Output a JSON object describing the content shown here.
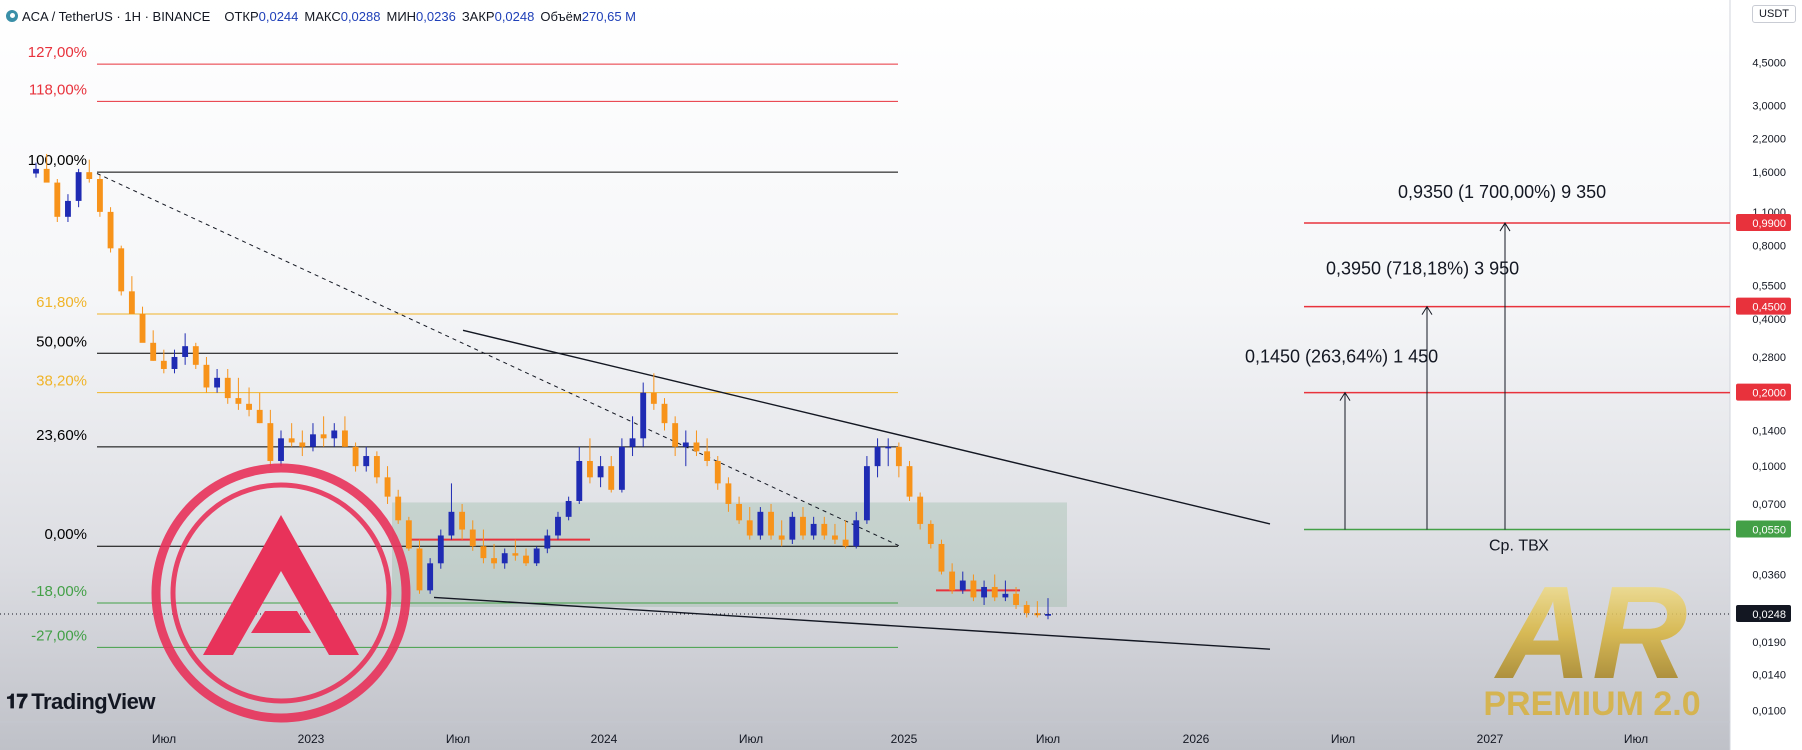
{
  "header": {
    "symbol": "ACA / TetherUS · 1H · BINANCE",
    "open_label": "ОТКР",
    "open_value": "0,0244",
    "high_label": "МАКС",
    "high_value": "0,0288",
    "low_label": "МИН",
    "low_value": "0,0236",
    "close_label": "ЗАКР",
    "close_value": "0,0248",
    "volume_label": "Объём",
    "volume_value": "270,65 M"
  },
  "currency": "USDT",
  "tradingview_label": "TradingView",
  "colors": {
    "up": "#1f2bb3",
    "down": "#f7931a",
    "red": "#e8323c",
    "green": "#43a047",
    "fib_gold": "#f0b429"
  },
  "chart_data": {
    "type": "candlestick",
    "y_scale": "log",
    "ylim": [
      0.0093,
      6.0
    ],
    "x_axis_labels": [
      "Июл",
      "2023",
      "Июл",
      "2024",
      "Июл",
      "2025",
      "Июл",
      "2026",
      "Июл",
      "2027",
      "Июл"
    ],
    "y_axis_labels": [
      "4,5000",
      "3,0000",
      "2,2000",
      "1,6000",
      "1,1000",
      "0,8000",
      "0,5500",
      "0,4000",
      "0,2800",
      "0,1400",
      "0,1000",
      "0,0700",
      "0,0360",
      "0,0190",
      "0,0140",
      "0,0100"
    ],
    "last_price": {
      "value": 0.0248,
      "label": "0,0248"
    },
    "price_tags": [
      {
        "value": 0.99,
        "label": "0,9900",
        "color": "#e8323c"
      },
      {
        "value": 0.45,
        "label": "0,4500",
        "color": "#e8323c"
      },
      {
        "value": 0.2,
        "label": "0,2000",
        "color": "#e8323c"
      },
      {
        "value": 0.055,
        "label": "0,0550",
        "color": "#43a047"
      }
    ],
    "fib_levels": [
      {
        "label": "127,00%",
        "value": 4.43,
        "color": "#e8323c"
      },
      {
        "label": "118,00%",
        "value": 3.12,
        "color": "#e8323c"
      },
      {
        "label": "100,00%",
        "value": 1.6,
        "color": "#000000"
      },
      {
        "label": "61,80%",
        "value": 0.42,
        "color": "#f0b429"
      },
      {
        "label": "50,00%",
        "value": 0.29,
        "color": "#000000"
      },
      {
        "label": "38,20%",
        "value": 0.2,
        "color": "#f0b429"
      },
      {
        "label": "23,60%",
        "value": 0.12,
        "color": "#000000"
      },
      {
        "label": "0,00%",
        "value": 0.047,
        "color": "#000000"
      },
      {
        "label": "-18,00%",
        "value": 0.0275,
        "color": "#43a047"
      },
      {
        "label": "-27,00%",
        "value": 0.0181,
        "color": "#43a047"
      }
    ],
    "targets": [
      {
        "label": "0,1450 (263,64%) 1 450",
        "from": 0.055,
        "to": 0.2
      },
      {
        "label": "0,3950 (718,18%) 3 950",
        "from": 0.055,
        "to": 0.45
      },
      {
        "label": "0,9350 (1 700,00%) 9 350",
        "from": 0.055,
        "to": 0.99
      }
    ],
    "entry_label": "Ср. ТВХ",
    "series": [
      {
        "values": [
          [
            1.58,
            1.75,
            1.52,
            1.65
          ],
          [
            1.65,
            1.9,
            1.55,
            1.45
          ],
          [
            1.45,
            1.5,
            1.0,
            1.05
          ],
          [
            1.05,
            1.3,
            1.0,
            1.22
          ],
          [
            1.22,
            1.65,
            1.15,
            1.6
          ],
          [
            1.6,
            1.8,
            1.45,
            1.5
          ],
          [
            1.5,
            1.55,
            1.05,
            1.1
          ],
          [
            1.1,
            1.15,
            0.75,
            0.78
          ],
          [
            0.78,
            0.8,
            0.5,
            0.52
          ],
          [
            0.52,
            0.6,
            0.45,
            0.42
          ],
          [
            0.42,
            0.45,
            0.33,
            0.32
          ],
          [
            0.32,
            0.36,
            0.27,
            0.27
          ],
          [
            0.27,
            0.3,
            0.24,
            0.25
          ],
          [
            0.25,
            0.3,
            0.24,
            0.28
          ],
          [
            0.28,
            0.35,
            0.26,
            0.31
          ],
          [
            0.31,
            0.32,
            0.25,
            0.26
          ],
          [
            0.26,
            0.28,
            0.2,
            0.21
          ],
          [
            0.21,
            0.25,
            0.2,
            0.23
          ],
          [
            0.23,
            0.25,
            0.18,
            0.19
          ],
          [
            0.19,
            0.23,
            0.17,
            0.18
          ],
          [
            0.18,
            0.21,
            0.16,
            0.17
          ],
          [
            0.17,
            0.2,
            0.15,
            0.15
          ],
          [
            0.15,
            0.17,
            0.1,
            0.105
          ],
          [
            0.105,
            0.14,
            0.1,
            0.13
          ],
          [
            0.13,
            0.15,
            0.12,
            0.125
          ],
          [
            0.125,
            0.14,
            0.11,
            0.12
          ],
          [
            0.12,
            0.15,
            0.115,
            0.135
          ],
          [
            0.135,
            0.16,
            0.12,
            0.13
          ],
          [
            0.13,
            0.15,
            0.12,
            0.14
          ],
          [
            0.14,
            0.16,
            0.12,
            0.12
          ],
          [
            0.12,
            0.125,
            0.095,
            0.1
          ],
          [
            0.1,
            0.12,
            0.095,
            0.11
          ],
          [
            0.11,
            0.115,
            0.085,
            0.09
          ],
          [
            0.09,
            0.1,
            0.07,
            0.075
          ],
          [
            0.075,
            0.08,
            0.058,
            0.06
          ],
          [
            0.06,
            0.062,
            0.045,
            0.046
          ],
          [
            0.046,
            0.05,
            0.03,
            0.031
          ],
          [
            0.031,
            0.042,
            0.03,
            0.04
          ],
          [
            0.04,
            0.055,
            0.038,
            0.052
          ],
          [
            0.052,
            0.085,
            0.05,
            0.065
          ],
          [
            0.065,
            0.07,
            0.05,
            0.055
          ],
          [
            0.055,
            0.06,
            0.045,
            0.047
          ],
          [
            0.047,
            0.055,
            0.04,
            0.042
          ],
          [
            0.042,
            0.048,
            0.038,
            0.04
          ],
          [
            0.04,
            0.046,
            0.038,
            0.044
          ],
          [
            0.044,
            0.05,
            0.041,
            0.043
          ],
          [
            0.043,
            0.046,
            0.039,
            0.04
          ],
          [
            0.04,
            0.047,
            0.039,
            0.046
          ],
          [
            0.046,
            0.055,
            0.044,
            0.052
          ],
          [
            0.052,
            0.065,
            0.05,
            0.062
          ],
          [
            0.062,
            0.075,
            0.06,
            0.072
          ],
          [
            0.072,
            0.12,
            0.07,
            0.105
          ],
          [
            0.105,
            0.13,
            0.085,
            0.09
          ],
          [
            0.09,
            0.11,
            0.082,
            0.1
          ],
          [
            0.1,
            0.11,
            0.078,
            0.08
          ],
          [
            0.08,
            0.13,
            0.078,
            0.12
          ],
          [
            0.12,
            0.16,
            0.11,
            0.13
          ],
          [
            0.13,
            0.22,
            0.12,
            0.2
          ],
          [
            0.2,
            0.24,
            0.17,
            0.18
          ],
          [
            0.18,
            0.19,
            0.14,
            0.15
          ],
          [
            0.15,
            0.16,
            0.11,
            0.12
          ],
          [
            0.12,
            0.14,
            0.1,
            0.125
          ],
          [
            0.125,
            0.14,
            0.11,
            0.115
          ],
          [
            0.115,
            0.13,
            0.1,
            0.105
          ],
          [
            0.105,
            0.11,
            0.08,
            0.085
          ],
          [
            0.085,
            0.09,
            0.065,
            0.07
          ],
          [
            0.07,
            0.075,
            0.058,
            0.06
          ],
          [
            0.06,
            0.068,
            0.05,
            0.052
          ],
          [
            0.052,
            0.068,
            0.05,
            0.065
          ],
          [
            0.065,
            0.07,
            0.05,
            0.052
          ],
          [
            0.052,
            0.06,
            0.047,
            0.05
          ],
          [
            0.05,
            0.065,
            0.048,
            0.062
          ],
          [
            0.062,
            0.068,
            0.05,
            0.052
          ],
          [
            0.052,
            0.062,
            0.05,
            0.058
          ],
          [
            0.058,
            0.062,
            0.05,
            0.052
          ],
          [
            0.052,
            0.058,
            0.048,
            0.05
          ],
          [
            0.05,
            0.06,
            0.046,
            0.047
          ],
          [
            0.047,
            0.065,
            0.046,
            0.06
          ],
          [
            0.06,
            0.11,
            0.058,
            0.1
          ],
          [
            0.1,
            0.13,
            0.09,
            0.12
          ],
          [
            0.12,
            0.13,
            0.1,
            0.12
          ],
          [
            0.12,
            0.125,
            0.09,
            0.1
          ],
          [
            0.1,
            0.105,
            0.072,
            0.075
          ],
          [
            0.075,
            0.078,
            0.055,
            0.058
          ],
          [
            0.058,
            0.06,
            0.046,
            0.048
          ],
          [
            0.048,
            0.05,
            0.036,
            0.037
          ],
          [
            0.037,
            0.04,
            0.03,
            0.031
          ],
          [
            0.031,
            0.037,
            0.03,
            0.034
          ],
          [
            0.034,
            0.036,
            0.028,
            0.029
          ],
          [
            0.029,
            0.034,
            0.027,
            0.032
          ],
          [
            0.032,
            0.036,
            0.028,
            0.029
          ],
          [
            0.029,
            0.034,
            0.028,
            0.03
          ],
          [
            0.03,
            0.032,
            0.026,
            0.027
          ],
          [
            0.027,
            0.028,
            0.024,
            0.025
          ],
          [
            0.025,
            0.028,
            0.024,
            0.0245
          ],
          [
            0.0244,
            0.0288,
            0.0236,
            0.0248
          ]
        ]
      }
    ]
  }
}
